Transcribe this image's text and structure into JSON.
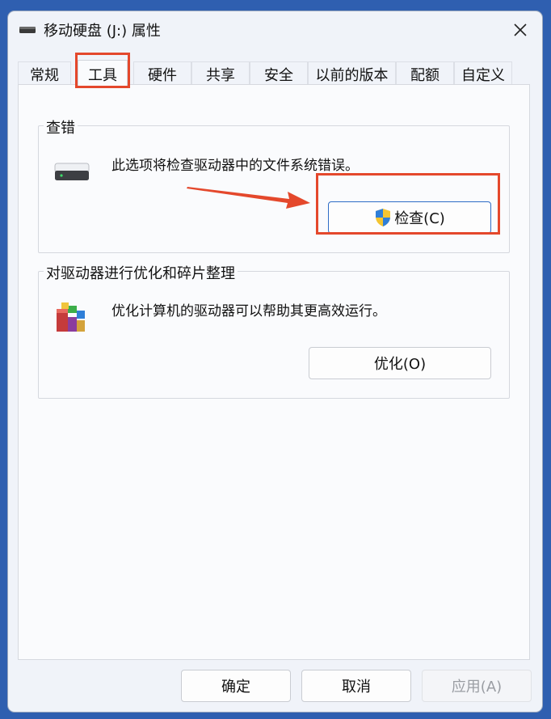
{
  "window": {
    "title": "移动硬盘 (J:) 属性",
    "close_symbol": "✕"
  },
  "tabs": [
    {
      "label": "常规"
    },
    {
      "label": "工具",
      "active": true
    },
    {
      "label": "硬件"
    },
    {
      "label": "共享"
    },
    {
      "label": "安全"
    },
    {
      "label": "以前的版本"
    },
    {
      "label": "配额"
    },
    {
      "label": "自定义"
    }
  ],
  "error_check": {
    "title": "查错",
    "description": "此选项将检查驱动器中的文件系统错误。",
    "button_label": "检查(C)",
    "button_icon": "uac-shield-icon"
  },
  "optimize": {
    "title": "对驱动器进行优化和碎片整理",
    "description": "优化计算机的驱动器可以帮助其更高效运行。",
    "button_label": "优化(O)",
    "icon": "defrag-icon"
  },
  "footer": {
    "ok_label": "确定",
    "cancel_label": "取消",
    "apply_label": "应用(A)"
  },
  "colors": {
    "annotation": "#e4482c",
    "background": "#2f5fb0",
    "accent": "#2e6cc6"
  }
}
